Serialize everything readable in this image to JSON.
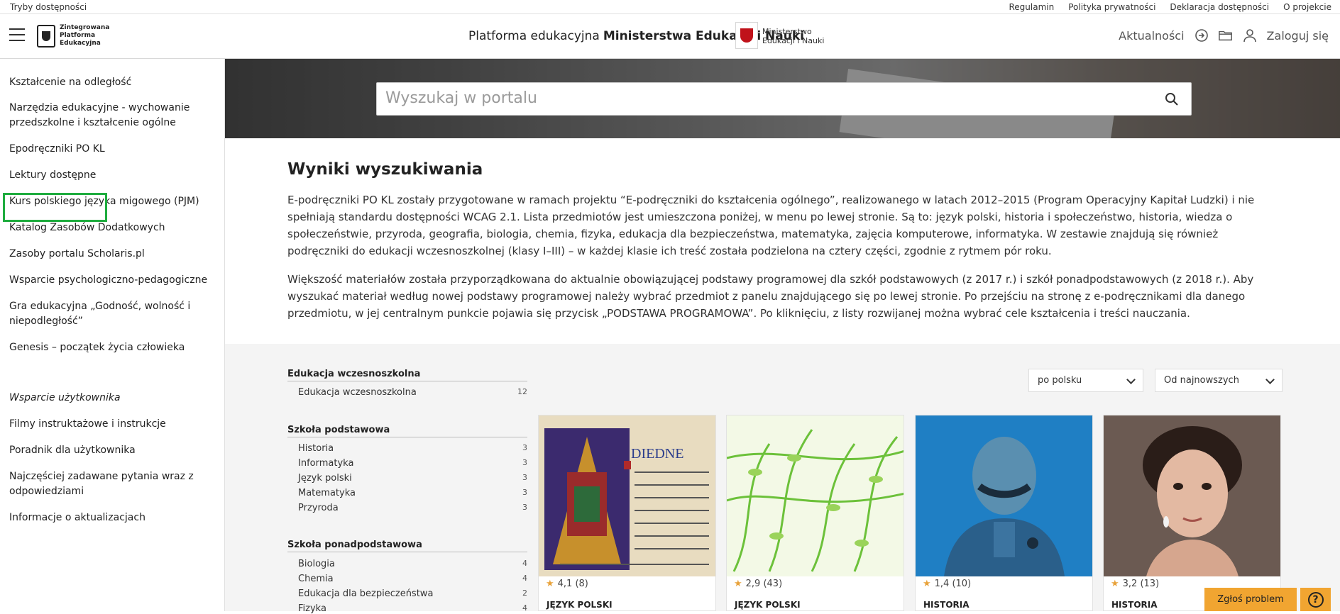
{
  "topbar": {
    "accessibility": "Tryby dostępności",
    "links": [
      "Regulamin",
      "Polityka prywatności",
      "Deklaracja dostępności",
      "O projekcie"
    ]
  },
  "header": {
    "logo_text": "Zintegrowana\nPlatforma\nEdukacyjna",
    "title_prefix": "Platforma edukacyjna",
    "title_bold": "Ministerstwa Edukacji i Nauki",
    "ministry": "Ministerstwo\nEdukacji i Nauki",
    "news": "Aktualności",
    "login": "Zaloguj się"
  },
  "sidebar": {
    "items": [
      "Kształcenie na odległość",
      "Narzędzia edukacyjne - wychowanie przedszkolne i kształcenie ogólne",
      "Epodręczniki PO KL",
      "Lektury dostępne",
      "Kurs polskiego języka migowego (PJM)",
      "Katalog Zasobów Dodatkowych",
      "Zasoby portalu Scholaris.pl",
      "Wsparcie psychologiczno-pedagogiczne",
      "Gra edukacyjna „Godność, wolność i niepodległość”",
      "Genesis – początek życia człowieka"
    ],
    "support_heading": "Wsparcie użytkownika",
    "support_items": [
      "Filmy instruktażowe i instrukcje",
      "Poradnik dla użytkownika",
      "Najczęściej zadawane pytania wraz z odpowiedziami",
      "Informacje o aktualizacjach"
    ]
  },
  "search": {
    "placeholder": "Wyszukaj w portalu"
  },
  "results": {
    "title": "Wyniki wyszukiwania",
    "para1": "E-podręczniki PO KL zostały przygotowane w ramach projektu “E-podręczniki do kształcenia ogólnego”, realizowanego w latach 2012–2015 (Program Operacyjny Kapitał Ludzki) i nie spełniają standardu dostępności WCAG 2.1. Lista przedmiotów jest umieszczona poniżej, w menu po lewej stronie. Są to: język polski, historia i społeczeństwo, historia, wiedza o społeczeństwie, przyroda, geografia, biologia, chemia, fizyka, edukacja dla bezpieczeństwa, matematyka, zajęcia komputerowe, informatyka. W zestawie znajdują się również podręczniki do edukacji wczesnoszkolnej (klasy I–III) – w każdej klasie ich treść została podzielona na cztery części, zgodnie z rytmem pór roku.",
    "para2": "Większość materiałów została przyporządkowana do aktualnie obowiązującej podstawy programowej dla szkół podstawowych (z 2017 r.) i szkół ponadpodstawowych (z 2018 r.). Aby wyszukać materiał według nowej podstawy programowej należy wybrać przedmiot z panelu znajdującego się po lewej stronie. Po przejściu na stronę z e-podręcznikami dla danego przedmiotu, w jej centralnym punkcie pojawia się przycisk „PODSTAWA PROGRAMOWA”. Po kliknięciu, z listy rozwijanej można wybrać cele kształcenia i treści nauczania."
  },
  "filters": {
    "groups": [
      {
        "heading": "Edukacja wczesnoszkolna",
        "items": [
          {
            "label": "Edukacja wczesnoszkolna",
            "count": "12"
          }
        ]
      },
      {
        "heading": "Szkoła podstawowa",
        "items": [
          {
            "label": "Historia",
            "count": "3"
          },
          {
            "label": "Informatyka",
            "count": "3"
          },
          {
            "label": "Język polski",
            "count": "3"
          },
          {
            "label": "Matematyka",
            "count": "3"
          },
          {
            "label": "Przyroda",
            "count": "3"
          }
        ]
      },
      {
        "heading": "Szkoła ponadpodstawowa",
        "items": [
          {
            "label": "Biologia",
            "count": "4"
          },
          {
            "label": "Chemia",
            "count": "4"
          },
          {
            "label": "Edukacja dla bezpieczeństwa",
            "count": "2"
          },
          {
            "label": "Fizyka",
            "count": "4"
          }
        ]
      }
    ]
  },
  "sorting": {
    "language": "po polsku",
    "order": "Od najnowszych"
  },
  "cards": [
    {
      "rating": "4,1 (8)",
      "subject": "JĘZYK POLSKI"
    },
    {
      "rating": "2,9 (43)",
      "subject": "JĘZYK POLSKI"
    },
    {
      "rating": "1,4 (10)",
      "subject": "HISTORIA"
    },
    {
      "rating": "3,2 (13)",
      "subject": "HISTORIA"
    }
  ],
  "floating": {
    "report": "Zgłoś problem",
    "help": "?"
  }
}
